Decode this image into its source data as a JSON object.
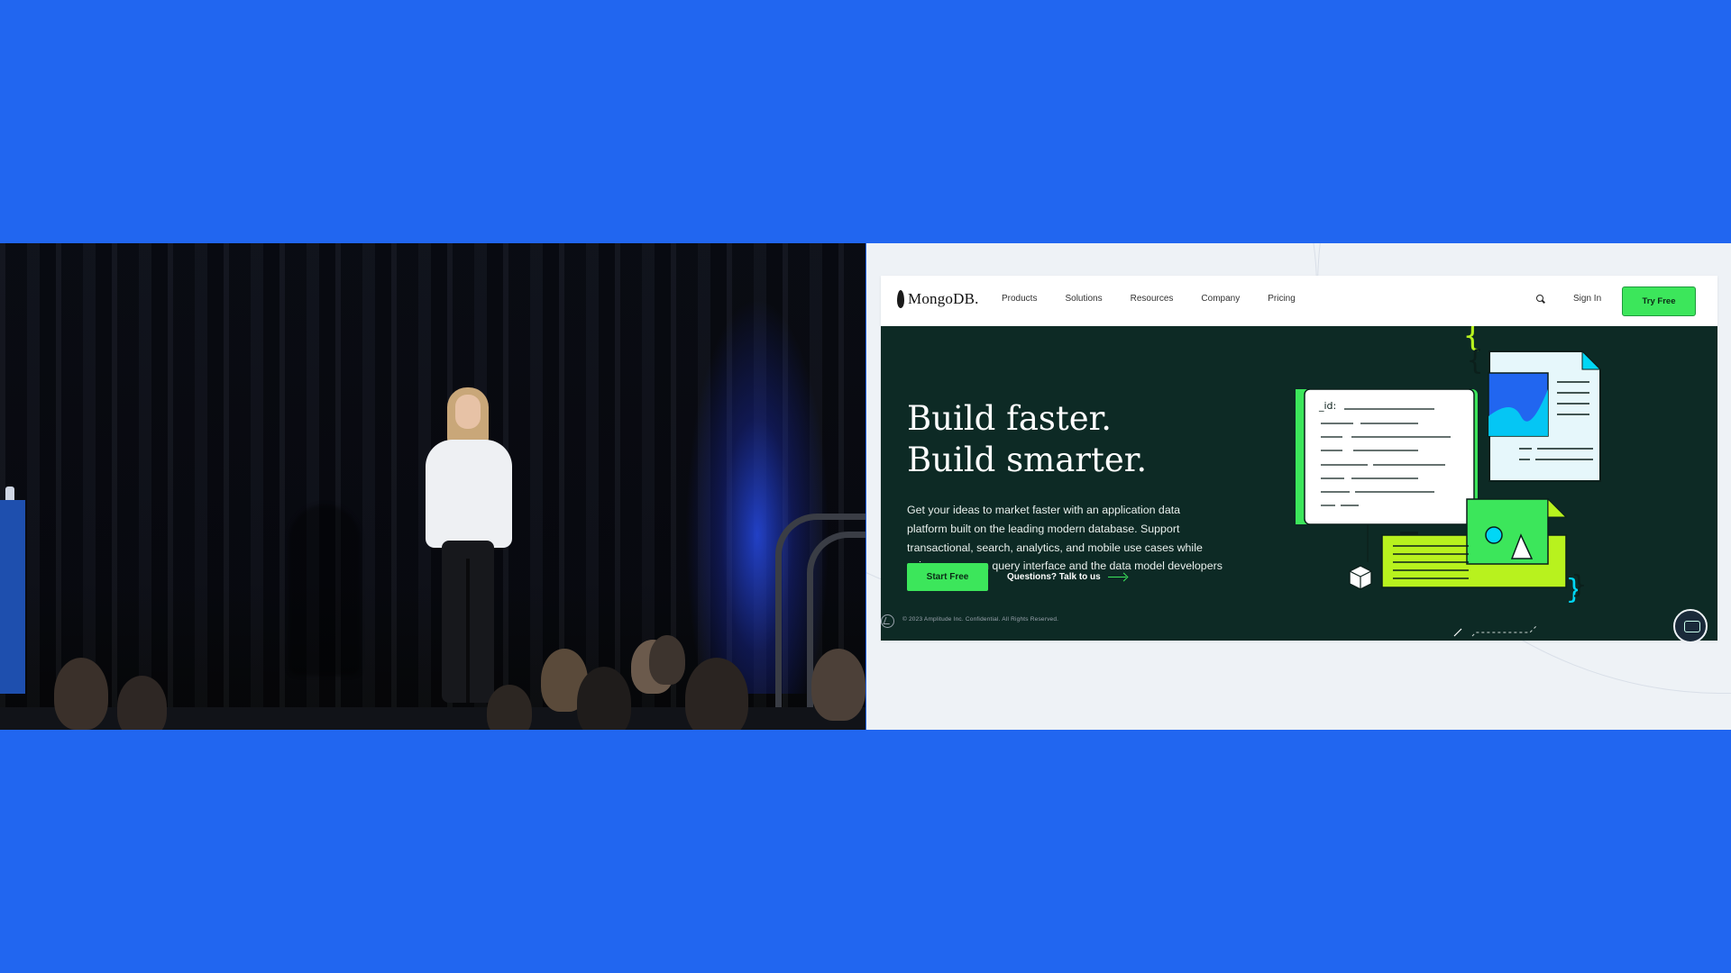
{
  "slide": {
    "logo_text": "MongoDB.",
    "nav": {
      "links": [
        "Products",
        "Solutions",
        "Resources",
        "Company",
        "Pricing"
      ],
      "sign_in": "Sign In",
      "try_free": "Try Free"
    },
    "hero": {
      "title_line1": "Build faster.",
      "title_line2": "Build smarter.",
      "body": "Get your ideas to market faster with an application data platform built on the leading modern database. Support transactional, search, analytics, and mobile use cases while using a common query interface and the data model developers love.",
      "start_button": "Start Free",
      "talk_link": "Questions? Talk to us",
      "illustration_label": "_id:"
    },
    "footer": "© 2023 Amplitude Inc. Confidential. All Rights Reserved."
  },
  "colors": {
    "background": "#2166f0",
    "hero_bg": "#0d2a25",
    "accent_green": "#3ce65b",
    "lime": "#b8f21e",
    "light_blue": "#e6f7fb"
  },
  "icons": [
    "leaf-logo-icon",
    "search-icon",
    "arrow-right-icon",
    "chat-icon",
    "amplitude-logo-icon"
  ]
}
